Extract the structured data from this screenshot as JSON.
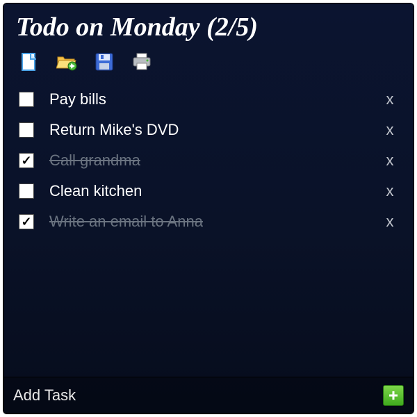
{
  "title": "Todo on Monday (2/5)",
  "toolbar": {
    "new_icon": "new-file-icon",
    "open_icon": "open-folder-icon",
    "save_icon": "save-icon",
    "print_icon": "print-icon"
  },
  "tasks": [
    {
      "label": "Pay bills",
      "done": false
    },
    {
      "label": "Return Mike's DVD",
      "done": false
    },
    {
      "label": "Call grandma",
      "done": true
    },
    {
      "label": "Clean kitchen",
      "done": false
    },
    {
      "label": "Write an email to Anna",
      "done": true
    }
  ],
  "delete_glyph": "x",
  "footer": {
    "add_label": "Add Task"
  }
}
